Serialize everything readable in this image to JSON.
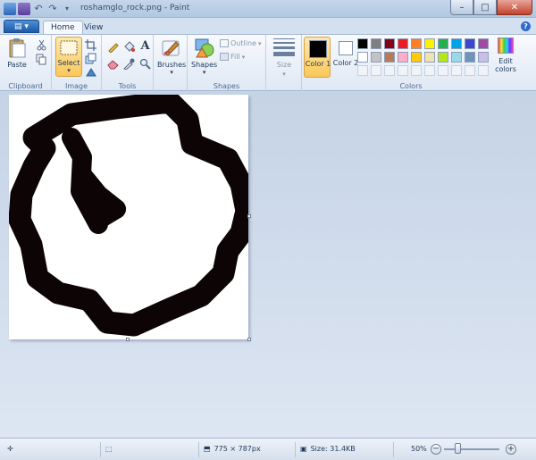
{
  "window": {
    "title": "roshamglo_rock.png - Paint",
    "min_glyph": "–",
    "max_glyph": "□",
    "close_glyph": "✕"
  },
  "tabs": {
    "file_glyph": "▤ ▾",
    "home": "Home",
    "view": "View",
    "help_glyph": "?"
  },
  "clipboard": {
    "paste": "Paste",
    "group": "Clipboard"
  },
  "image": {
    "select": "Select",
    "group": "Image"
  },
  "tools": {
    "group": "Tools",
    "text_glyph": "A"
  },
  "brushes": {
    "label": "Brushes"
  },
  "shapes": {
    "shapes": "Shapes",
    "outline": "Outline",
    "fill": "Fill",
    "group": "Shapes"
  },
  "size": {
    "label": "Size"
  },
  "colors": {
    "color1": "Color 1",
    "color2": "Color 2",
    "edit": "Edit colors",
    "group": "Colors",
    "color1_value": "#000000",
    "color2_value": "#ffffff",
    "palette_row1": [
      "#000000",
      "#7f7f7f",
      "#880015",
      "#ed1c24",
      "#ff7f27",
      "#fff200",
      "#22b14c",
      "#00a2e8",
      "#3f48cc",
      "#a349a4"
    ],
    "palette_row2": [
      "#ffffff",
      "#c3c3c3",
      "#b97a57",
      "#ffaec9",
      "#ffc90e",
      "#efe4b0",
      "#b5e61d",
      "#99d9ea",
      "#7092be",
      "#c8bfe7"
    ]
  },
  "status": {
    "dimensions": "775 × 787px",
    "size": "Size: 31.4KB",
    "zoom": "50%",
    "zoom_out": "−",
    "zoom_in": "+",
    "zoom_level": 0.5
  }
}
